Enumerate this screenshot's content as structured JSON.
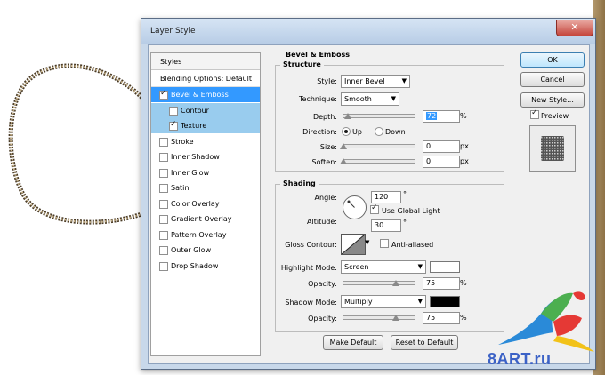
{
  "window": {
    "title": "Layer Style",
    "close_glyph": "✕"
  },
  "styles_panel": {
    "header": "Styles",
    "blending_options": "Blending Options: Default",
    "items": [
      {
        "label": "Bevel & Emboss",
        "checked": true,
        "selected": true,
        "indent": false
      },
      {
        "label": "Contour",
        "checked": false,
        "selected": false,
        "indent": true
      },
      {
        "label": "Texture",
        "checked": true,
        "selected": false,
        "indent": true
      },
      {
        "label": "Stroke",
        "checked": false,
        "selected": false,
        "indent": false
      },
      {
        "label": "Inner Shadow",
        "checked": false,
        "selected": false,
        "indent": false
      },
      {
        "label": "Inner Glow",
        "checked": false,
        "selected": false,
        "indent": false
      },
      {
        "label": "Satin",
        "checked": false,
        "selected": false,
        "indent": false
      },
      {
        "label": "Color Overlay",
        "checked": false,
        "selected": false,
        "indent": false
      },
      {
        "label": "Gradient Overlay",
        "checked": false,
        "selected": false,
        "indent": false
      },
      {
        "label": "Pattern Overlay",
        "checked": false,
        "selected": false,
        "indent": false
      },
      {
        "label": "Outer Glow",
        "checked": false,
        "selected": false,
        "indent": false
      },
      {
        "label": "Drop Shadow",
        "checked": false,
        "selected": false,
        "indent": false
      }
    ]
  },
  "bevel": {
    "section_title": "Bevel & Emboss",
    "structure_title": "Structure",
    "style_label": "Style:",
    "style_value": "Inner Bevel",
    "technique_label": "Technique:",
    "technique_value": "Smooth",
    "depth_label": "Depth:",
    "depth_value": "72",
    "depth_unit": "%",
    "depth_level": 0.072,
    "direction_label": "Direction:",
    "direction_up": "Up",
    "direction_down": "Down",
    "direction_selected": "Up",
    "size_label": "Size:",
    "size_value": "0",
    "size_unit": "px",
    "soften_label": "Soften:",
    "soften_value": "0",
    "soften_unit": "px"
  },
  "shading": {
    "title": "Shading",
    "angle_label": "Angle:",
    "angle_value": "120",
    "angle_unit": "°",
    "use_global_light": "Use Global Light",
    "use_global_light_checked": true,
    "altitude_label": "Altitude:",
    "altitude_value": "30",
    "altitude_unit": "°",
    "gloss_contour_label": "Gloss Contour:",
    "anti_aliased": "Anti-aliased",
    "anti_aliased_checked": false,
    "highlight_mode_label": "Highlight Mode:",
    "highlight_mode_value": "Screen",
    "highlight_color": "#ffffff",
    "highlight_opacity_label": "Opacity:",
    "highlight_opacity_value": "75",
    "highlight_opacity_unit": "%",
    "shadow_mode_label": "Shadow Mode:",
    "shadow_mode_value": "Multiply",
    "shadow_color": "#000000",
    "shadow_opacity_label": "Opacity:",
    "shadow_opacity_value": "75",
    "shadow_opacity_unit": "%",
    "opacity_level": 0.75
  },
  "bottom_buttons": {
    "make_default": "Make Default",
    "reset_to_default": "Reset to Default"
  },
  "right_panel": {
    "ok": "OK",
    "cancel": "Cancel",
    "new_style": "New Style...",
    "preview": "Preview",
    "preview_checked": true
  },
  "watermark": {
    "text": "8ART.ru"
  },
  "colors": {
    "selection": "#3399ff",
    "sub_item": "#99ccee",
    "titlebar": "#c8d8ea"
  }
}
